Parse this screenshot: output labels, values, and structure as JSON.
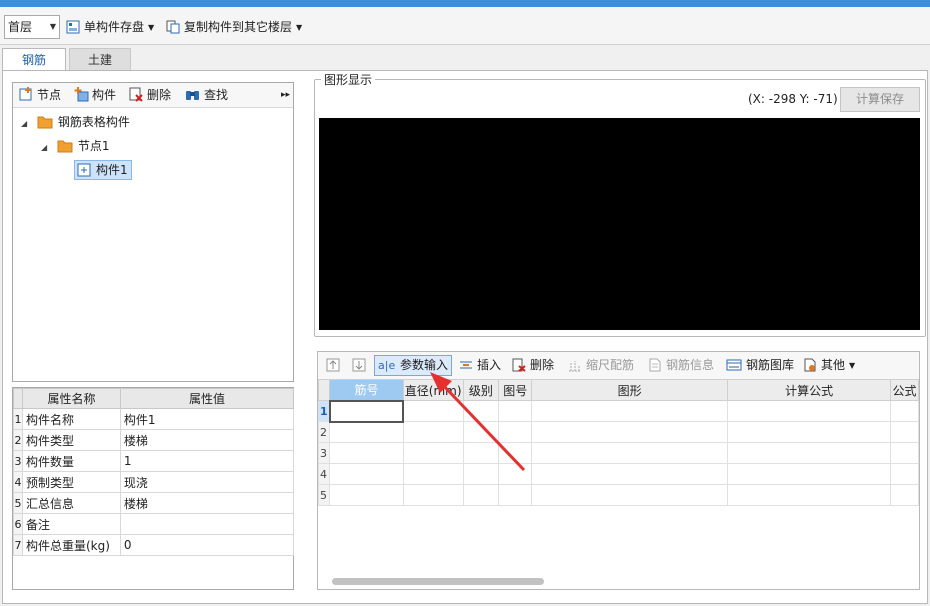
{
  "toolbar": {
    "floor_value": "首层",
    "save_single": "单构件存盘",
    "copy_to_floors": "复制构件到其它楼层"
  },
  "tabs": [
    {
      "label": "钢筋",
      "active": true
    },
    {
      "label": "土建",
      "active": false
    }
  ],
  "tree_toolbar": {
    "node": "节点",
    "component": "构件",
    "delete": "删除",
    "find": "查找"
  },
  "tree": {
    "root": "钢筋表格构件",
    "node": "节点1",
    "leaf": "构件1"
  },
  "properties": {
    "header_name": "属性名称",
    "header_value": "属性值",
    "rows": [
      {
        "num": "1",
        "name": "构件名称",
        "value": "构件1"
      },
      {
        "num": "2",
        "name": "构件类型",
        "value": "楼梯"
      },
      {
        "num": "3",
        "name": "构件数量",
        "value": "1"
      },
      {
        "num": "4",
        "name": "预制类型",
        "value": "现浇"
      },
      {
        "num": "5",
        "name": "汇总信息",
        "value": "楼梯"
      },
      {
        "num": "6",
        "name": "备注",
        "value": ""
      },
      {
        "num": "7",
        "name": "构件总重量(kg)",
        "value": "0"
      }
    ]
  },
  "graph": {
    "legend": "图形显示",
    "coords": "(X: -298 Y: -71)",
    "calc_save": "计算保存"
  },
  "rebar_toolbar": {
    "param_input": "参数输入",
    "insert": "插入",
    "delete": "删除",
    "scale_rebar": "缩尺配筋",
    "rebar_info": "钢筋信息",
    "rebar_library": "钢筋图库",
    "other": "其他"
  },
  "rebar_grid": {
    "columns": [
      "筋号",
      "直径(mm)",
      "级别",
      "图号",
      "图形",
      "计算公式",
      "公式"
    ],
    "rows": [
      "1",
      "2",
      "3",
      "4",
      "5"
    ]
  },
  "colors": {
    "accent": "#3d8fe0",
    "annotation_arrow": "#e53030",
    "canvas": "#000000"
  }
}
